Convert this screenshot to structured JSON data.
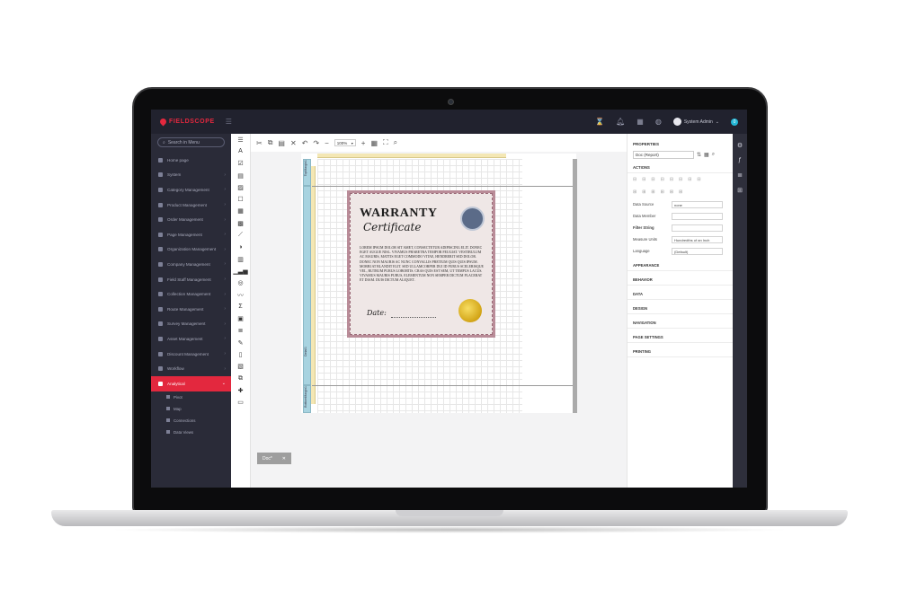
{
  "topbar": {
    "brand": "FIELDSCOPE",
    "user_name": "System Admin",
    "notif_count": "0"
  },
  "sidebar": {
    "search_placeholder": "Search in Menu",
    "items": [
      {
        "label": "Home page"
      },
      {
        "label": "System"
      },
      {
        "label": "Category Management"
      },
      {
        "label": "Product Management"
      },
      {
        "label": "Order Management"
      },
      {
        "label": "Page Management"
      },
      {
        "label": "Organization Management"
      },
      {
        "label": "Company Management"
      },
      {
        "label": "Field Staff Management"
      },
      {
        "label": "Collection Management"
      },
      {
        "label": "Route Management"
      },
      {
        "label": "Survey Management"
      },
      {
        "label": "Asset Management"
      },
      {
        "label": "Discount Management"
      },
      {
        "label": "Workflow"
      },
      {
        "label": "Analytical"
      }
    ],
    "sub_items": [
      {
        "label": "Pivot"
      },
      {
        "label": "Map"
      },
      {
        "label": "Connections"
      },
      {
        "label": "Data Views"
      }
    ]
  },
  "designer": {
    "zoom": "100%",
    "doc_tab": "Doc*",
    "band_top": "TopMargin1",
    "band_detail": "Detail1",
    "band_bottom": "BottomMargin1"
  },
  "certificate": {
    "title": "WARRANTY",
    "subtitle": "Certificate",
    "body": "Lorem ipsum dolor sit amet, consectetur adipiscing elit. Donec eget augue nisl. Vivamus pharetra tempor feugiat. Vestibulum ac mauris, mattis eget commodo vitae, hendrerit sed dolor. Donec non mauris ac nunc convallis pretium quis quis ipsum. Morbi at blandit elit. Sed ullamcorper dui id purus scelerisque vel, rutrum purus lobortis. Cras quis est sem, ut tempus lacus. Vivamus mauris purus, elementum non semper dictum placerat et diam. Duis dictum aliquet.",
    "date_label": "Date:"
  },
  "properties": {
    "title": "PROPERTIES",
    "selected": "Doc (Report)",
    "sections": {
      "actions": "ACTIONS",
      "appearance": "APPEARANCE",
      "behavior": "BEHAVIOR",
      "data": "DATA",
      "design": "DESIGN",
      "navigation": "NAVIGATION",
      "page_settings": "PAGE SETTINGS",
      "printing": "PRINTING"
    },
    "rows": [
      {
        "label": "Data Source",
        "value": "none"
      },
      {
        "label": "Data Member",
        "value": ""
      },
      {
        "label": "Filter String",
        "value": ""
      },
      {
        "label": "Measure Units",
        "value": "Hundredths of an Inch"
      },
      {
        "label": "Language",
        "value": "(Default)"
      }
    ]
  }
}
